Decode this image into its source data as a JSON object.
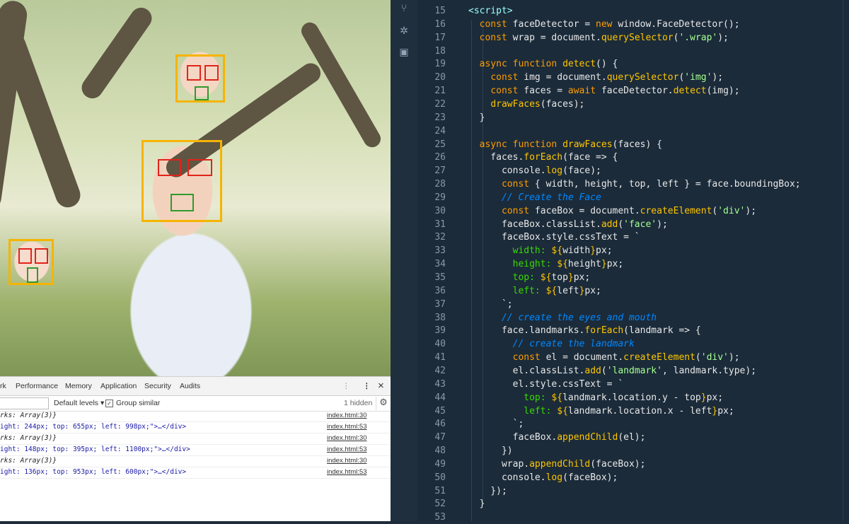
{
  "devtools": {
    "tabs": [
      "rk",
      "Performance",
      "Memory",
      "Application",
      "Security",
      "Audits"
    ],
    "hidden_count": "1 hidden",
    "default_levels": "Default levels",
    "group_similar": "Group similar",
    "console_lines": [
      {
        "text": "rks: Array(3)}",
        "source": "index.html:30"
      },
      {
        "text": "ight: 244px; top: 655px; left: 998px;\">…</div>",
        "source": "index.html:53"
      },
      {
        "text": "rks: Array(3)}",
        "source": "index.html:30"
      },
      {
        "text": "ight: 148px; top: 395px; left: 1100px;\">…</div>",
        "source": "index.html:53"
      },
      {
        "text": "rks: Array(3)}",
        "source": "index.html:30"
      },
      {
        "text": "ight: 136px; top: 953px; left: 600px;\">…</div>",
        "source": "index.html:53"
      }
    ]
  },
  "editor": {
    "line_numbers": [
      "15",
      "16",
      "17",
      "18",
      "19",
      "20",
      "21",
      "22",
      "23",
      "24",
      "25",
      "26",
      "27",
      "28",
      "29",
      "30",
      "31",
      "32",
      "33",
      "34",
      "35",
      "36",
      "37",
      "38",
      "39",
      "40",
      "41",
      "42",
      "43",
      "44",
      "45",
      "46",
      "47",
      "48",
      "49",
      "50",
      "51",
      "52",
      "53"
    ],
    "lines": [
      "<script>",
      "  const faceDetector = new window.FaceDetector();",
      "  const wrap = document.querySelector('.wrap');",
      "",
      "  async function detect() {",
      "    const img = document.querySelector('img');",
      "    const faces = await faceDetector.detect(img);",
      "    drawFaces(faces);",
      "  }",
      "",
      "  async function drawFaces(faces) {",
      "    faces.forEach(face => {",
      "      console.log(face);",
      "      const { width, height, top, left } = face.boundingBox;",
      "      // Create the Face",
      "      const faceBox = document.createElement('div');",
      "      faceBox.classList.add('face');",
      "      faceBox.style.cssText = `",
      "        width: ${width}px;",
      "        height: ${height}px;",
      "        top: ${top}px;",
      "        left: ${left}px;",
      "      `;",
      "      // create the eyes and mouth",
      "      face.landmarks.forEach(landmark => {",
      "        // create the landmark",
      "        const el = document.createElement('div');",
      "        el.classList.add('landmark', landmark.type);",
      "        el.style.cssText = `",
      "          top: ${landmark.location.y - top}px;",
      "          left: ${landmark.location.x - left}px;",
      "        `;",
      "        faceBox.appendChild(el);",
      "      })",
      "      wrap.appendChild(faceBox);",
      "      console.log(faceBox);",
      "    });",
      "  }",
      ""
    ]
  }
}
